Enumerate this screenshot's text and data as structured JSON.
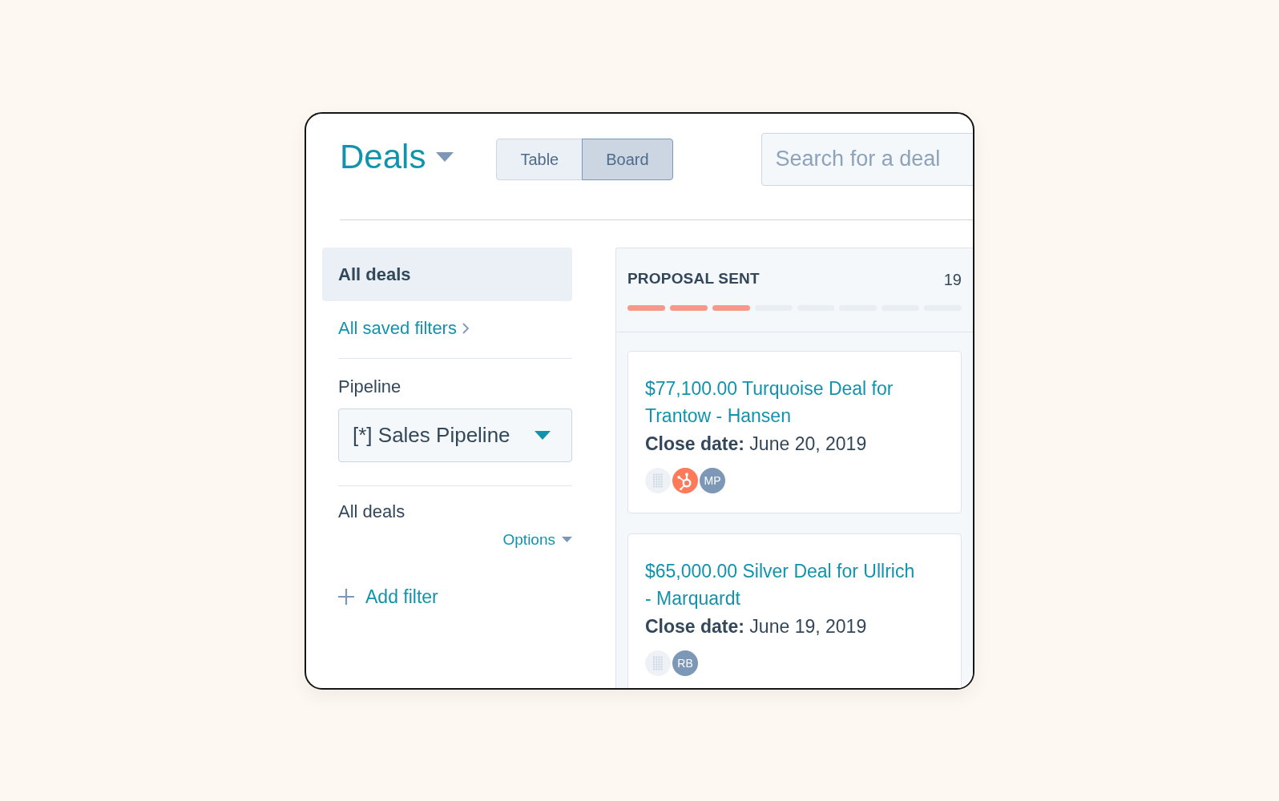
{
  "header": {
    "title": "Deals",
    "view_tabs": [
      {
        "label": "Table",
        "selected": false
      },
      {
        "label": "Board",
        "selected": true
      }
    ],
    "search": {
      "placeholder": "Search for a deal"
    }
  },
  "sidebar": {
    "views": [
      {
        "label": "All deals",
        "selected": true
      }
    ],
    "saved_filters_link": "All saved filters",
    "pipeline": {
      "label": "Pipeline",
      "value": "[*] Sales Pipeline"
    },
    "current_view": {
      "label": "All deals",
      "options": "Options"
    },
    "add_filter": "Add filter"
  },
  "board_column": {
    "title": "PROPOSAL SENT",
    "count": "19",
    "stage_segments": [
      {
        "filled": true
      },
      {
        "filled": true
      },
      {
        "filled": true
      },
      {
        "filled": false
      },
      {
        "filled": false
      },
      {
        "filled": false
      },
      {
        "filled": false
      },
      {
        "filled": false
      }
    ],
    "cards": [
      {
        "title": "$77,100.00 Turquoise Deal for Trantow - Hansen",
        "close_date": "**Close date:** June 20, 2019",
        "avatars": [
          {
            "kind": "company"
          },
          {
            "kind": "brand"
          },
          {
            "kind": "initials",
            "text": "MP"
          }
        ]
      },
      {
        "title": "$65,000.00 Silver Deal for Ullrich - Marquardt",
        "close_date": "**Close date:** June 19, 2019",
        "avatars": [
          {
            "kind": "company"
          },
          {
            "kind": "initials",
            "text": "RB"
          }
        ]
      }
    ]
  }
}
